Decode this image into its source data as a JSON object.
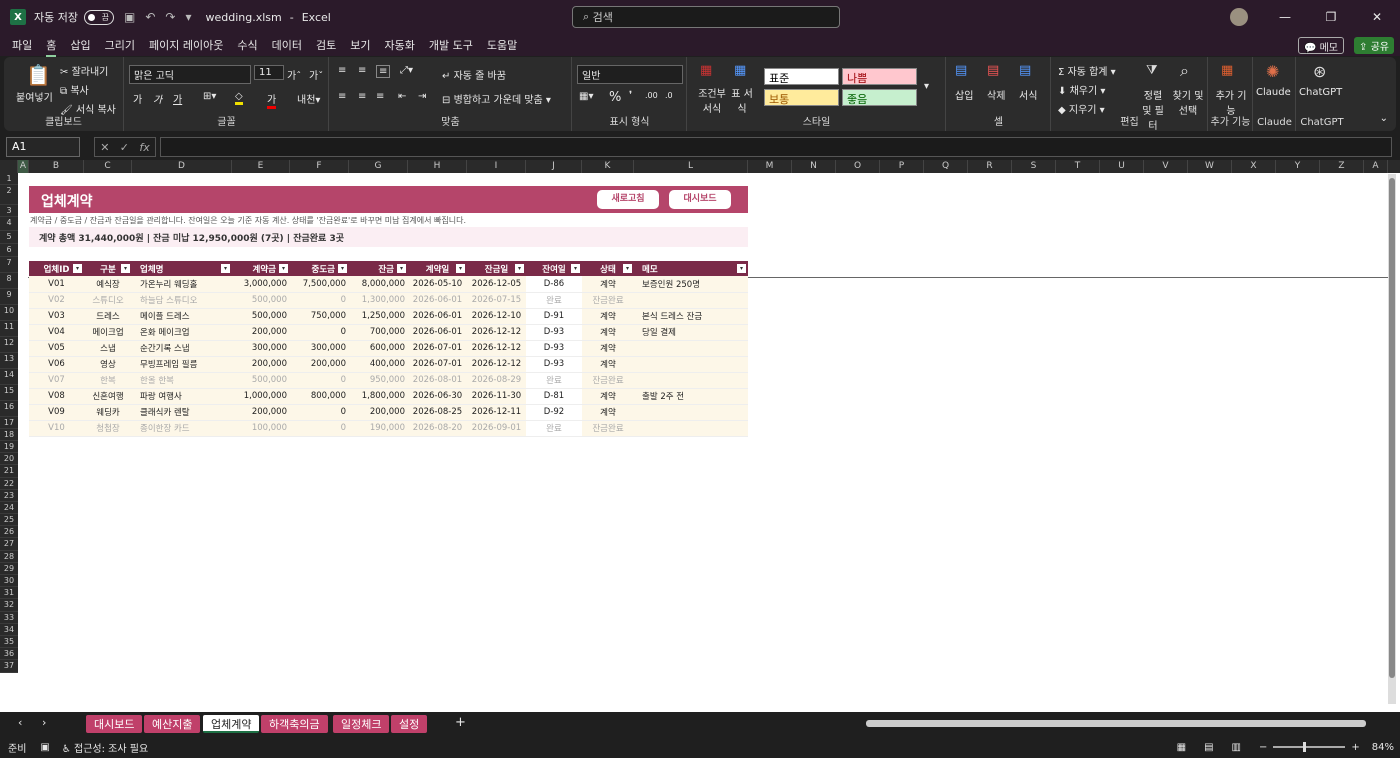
{
  "titlebar": {
    "autosave": "자동 저장",
    "toggle": "끔",
    "filename": "wedding.xlsm",
    "app": "Excel",
    "search_placeholder": "검색"
  },
  "menu": [
    "파일",
    "홈",
    "삽입",
    "그리기",
    "페이지 레이아웃",
    "수식",
    "데이터",
    "검토",
    "보기",
    "자동화",
    "개발 도구",
    "도움말"
  ],
  "menu_memo": "메모",
  "menu_share": "공유",
  "ribbon": {
    "paste": "붙여넣기",
    "cut": "잘라내기",
    "copy": "복사",
    "format_copy": "서식 복사",
    "clipboard": "클립보드",
    "font_name": "맑은 고딕",
    "font_size": "11",
    "font_group": "글꼴",
    "wrap": "자동 줄 바꿈",
    "merge": "병합하고 가운데 맞춤",
    "align_group": "맞춤",
    "number_format": "일반",
    "number_group": "표시 형식",
    "cond_format": "조건부 서식",
    "table_format": "표 서식",
    "style_normal": "표준",
    "style_bad": "나쁨",
    "style_neutral": "보통",
    "style_good": "좋음",
    "style_group": "스타일",
    "insert": "삽입",
    "delete": "삭제",
    "format": "서식",
    "cell_group": "셀",
    "autosum": "자동 합계",
    "fill": "채우기",
    "clear": "지우기",
    "sort": "정렬 및 필터",
    "find": "찾기 및 선택",
    "edit_group": "편집",
    "addin": "추가 기능",
    "addin_group": "추가 기능",
    "claude": "Claude",
    "claude_group": "Claude",
    "chatgpt": "ChatGPT",
    "chatgpt_group": "ChatGPT"
  },
  "namebox": "A1",
  "columns": [
    "A",
    "B",
    "C",
    "D",
    "E",
    "F",
    "G",
    "H",
    "I",
    "J",
    "K",
    "L",
    "M",
    "N",
    "O",
    "P",
    "Q",
    "R",
    "S",
    "T",
    "U",
    "V",
    "W",
    "X",
    "Y",
    "Z",
    "A"
  ],
  "rows": [
    "1",
    "2",
    "3",
    "4",
    "5",
    "6",
    "7",
    "8",
    "9",
    "10",
    "11",
    "12",
    "13",
    "14",
    "15",
    "16",
    "17",
    "18",
    "19",
    "20",
    "21",
    "22",
    "23",
    "24",
    "25",
    "26",
    "27",
    "28",
    "29",
    "30",
    "31",
    "32",
    "33",
    "34",
    "35",
    "36",
    "37"
  ],
  "sheet": {
    "title": "업체계약",
    "refresh_btn": "새로고침",
    "dashboard_btn": "대시보드",
    "note": "계약금 / 중도금 / 잔금과 잔금일을 관리합니다. 잔여일은 오늘 기준 자동 계산. 상태를 '잔금완료'로 바꾸면 미납 집계에서 빠집니다.",
    "summary": "계약 총액 31,440,000원   |   잔금 미납 12,950,000원 (7곳)   |   잔금완료 3곳",
    "headers": [
      "업체ID",
      "구분",
      "업체명",
      "계약금",
      "중도금",
      "잔금",
      "계약일",
      "잔금일",
      "잔여일",
      "상태",
      "메모"
    ],
    "rows": [
      {
        "id": "V01",
        "type": "예식장",
        "name": "가온누리 웨딩홀",
        "dep": "3,000,000",
        "mid": "7,500,000",
        "bal": "8,000,000",
        "cdate": "2026-05-10",
        "bdate": "2026-12-05",
        "left": "D-86",
        "status": "계약",
        "memo": "보증인원 250명",
        "done": false
      },
      {
        "id": "V02",
        "type": "스튜디오",
        "name": "하늘담 스튜디오",
        "dep": "500,000",
        "mid": "0",
        "bal": "1,300,000",
        "cdate": "2026-06-01",
        "bdate": "2026-07-15",
        "left": "완료",
        "status": "잔금완료",
        "memo": "",
        "done": true
      },
      {
        "id": "V03",
        "type": "드레스",
        "name": "메이플 드레스",
        "dep": "500,000",
        "mid": "750,000",
        "bal": "1,250,000",
        "cdate": "2026-06-01",
        "bdate": "2026-12-10",
        "left": "D-91",
        "status": "계약",
        "memo": "본식 드레스 잔금",
        "done": false
      },
      {
        "id": "V04",
        "type": "메이크업",
        "name": "온화 메이크업",
        "dep": "200,000",
        "mid": "0",
        "bal": "700,000",
        "cdate": "2026-06-01",
        "bdate": "2026-12-12",
        "left": "D-93",
        "status": "계약",
        "memo": "당일 결제",
        "done": false
      },
      {
        "id": "V05",
        "type": "스냅",
        "name": "순간기록 스냅",
        "dep": "300,000",
        "mid": "300,000",
        "bal": "600,000",
        "cdate": "2026-07-01",
        "bdate": "2026-12-12",
        "left": "D-93",
        "status": "계약",
        "memo": "",
        "done": false
      },
      {
        "id": "V06",
        "type": "영상",
        "name": "무빙프레임 필름",
        "dep": "200,000",
        "mid": "200,000",
        "bal": "400,000",
        "cdate": "2026-07-01",
        "bdate": "2026-12-12",
        "left": "D-93",
        "status": "계약",
        "memo": "",
        "done": false
      },
      {
        "id": "V07",
        "type": "한복",
        "name": "한올 한복",
        "dep": "500,000",
        "mid": "0",
        "bal": "950,000",
        "cdate": "2026-08-01",
        "bdate": "2026-08-29",
        "left": "완료",
        "status": "잔금완료",
        "memo": "",
        "done": true
      },
      {
        "id": "V08",
        "type": "신혼여행",
        "name": "파랑 여행사",
        "dep": "1,000,000",
        "mid": "800,000",
        "bal": "1,800,000",
        "cdate": "2026-06-30",
        "bdate": "2026-11-30",
        "left": "D-81",
        "status": "계약",
        "memo": "출발 2주 전",
        "done": false
      },
      {
        "id": "V09",
        "type": "웨딩카",
        "name": "클래식카 렌탈",
        "dep": "200,000",
        "mid": "0",
        "bal": "200,000",
        "cdate": "2026-08-25",
        "bdate": "2026-12-11",
        "left": "D-92",
        "status": "계약",
        "memo": "",
        "done": false
      },
      {
        "id": "V10",
        "type": "청첩장",
        "name": "종이한장 카드",
        "dep": "100,000",
        "mid": "0",
        "bal": "190,000",
        "cdate": "2026-08-20",
        "bdate": "2026-09-01",
        "left": "완료",
        "status": "잔금완료",
        "memo": "",
        "done": true
      }
    ]
  },
  "tabs": [
    "대시보드",
    "예산지출",
    "업체계약",
    "하객축의금",
    "일정체크",
    "설정"
  ],
  "status": {
    "ready": "준비",
    "accessibility": "접근성: 조사 필요",
    "zoom": "84%"
  }
}
